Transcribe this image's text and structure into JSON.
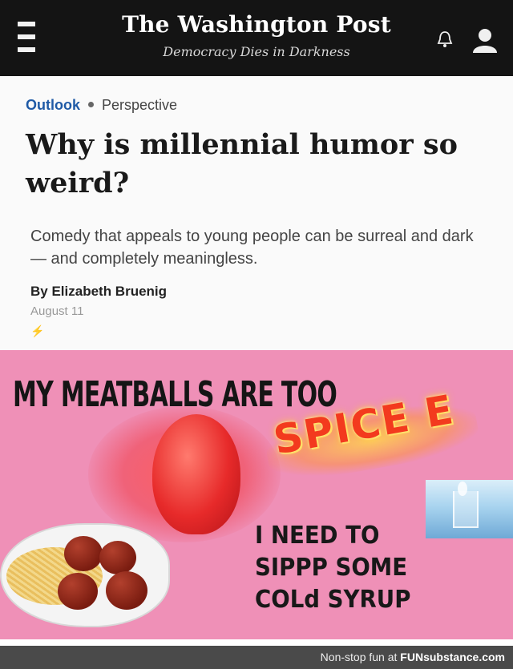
{
  "header": {
    "logo": "The Washington Post",
    "tagline": "Democracy Dies in Darkness",
    "menu_icon": "hamburger-menu-icon",
    "bell_icon": "bell-icon",
    "user_icon": "user-icon",
    "background": "#141414"
  },
  "article": {
    "section": "Outlook",
    "label": "Perspective",
    "headline": "Why is millennial humor so weird?",
    "dek": "Comedy that appeals to young people can be surreal and dark — and completely meaningless.",
    "byline": "By Elizabeth Bruenig",
    "date": "August 11",
    "bolt_icon": "⚡",
    "section_color": "#1f5aa6"
  },
  "meme": {
    "top_text": "MY MEATBALLS ARE TOO",
    "spice_text": "SPICE E",
    "lines": [
      "I NEED TO",
      "SIPPP SOME",
      "COLd SYRUP"
    ],
    "background": "#ef90b7"
  },
  "footer": {
    "credit_prefix": "Non-stop fun at ",
    "credit_brand": "FUNsubstance.com"
  }
}
